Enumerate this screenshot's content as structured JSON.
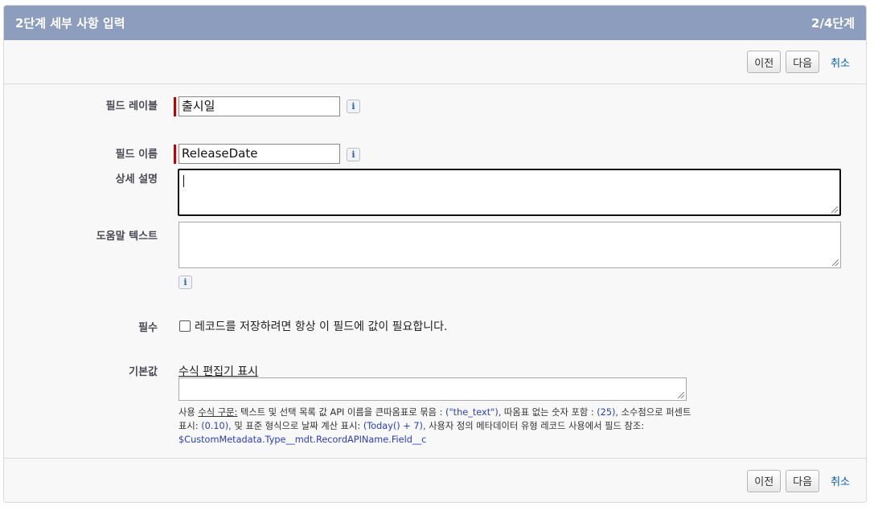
{
  "header": {
    "title": "2단계 세부 사항 입력",
    "step": "2/4단계"
  },
  "buttons": {
    "prev": "이전",
    "next": "다음",
    "cancel": "취소"
  },
  "fields": {
    "field_label": {
      "label": "필드 레이블",
      "value": "출시일"
    },
    "field_name": {
      "label": "필드 이름",
      "value": "ReleaseDate"
    },
    "description": {
      "label": "상세 설명",
      "value": ""
    },
    "help_text": {
      "label": "도움말 텍스트",
      "value": ""
    },
    "required": {
      "label": "필수",
      "checkbox_text": "레코드를 저장하려면 항상 이 필드에 값이 필요합니다.",
      "checked": false
    },
    "default_value": {
      "label": "기본값",
      "editor_link": "수식 편집기 표시",
      "value": ""
    }
  },
  "hint": {
    "p1": "사용 ",
    "formula_syntax": "수식 구문:",
    "p2": " 텍스트 및 선택 목록 값 API 이름을 큰따옴표로 묶음 : ",
    "ex_text": "(\"the_text\"),",
    "p3": " 따옴표 없는 숫자 포함 : ",
    "ex_number": "(25),",
    "p4": " 소수점으로 퍼센트 표시: ",
    "ex_percent": "(0.10),",
    "p5": " 및 표준 형식으로 날짜 계산 표시: ",
    "ex_date": "(Today() + 7),",
    "p6": " 사용자 정의 메타데이터 유형 레코드 사용에서 필드 참조: ",
    "ex_metadata": "$CustomMetadata.Type__mdt.RecordAPIName.Field__c"
  },
  "info_icon": "info-icon",
  "colors": {
    "header_bg": "#8d9dbd",
    "required_bar": "#c00000",
    "link": "#015ba7",
    "hint_blue": "#2a3fb8"
  }
}
